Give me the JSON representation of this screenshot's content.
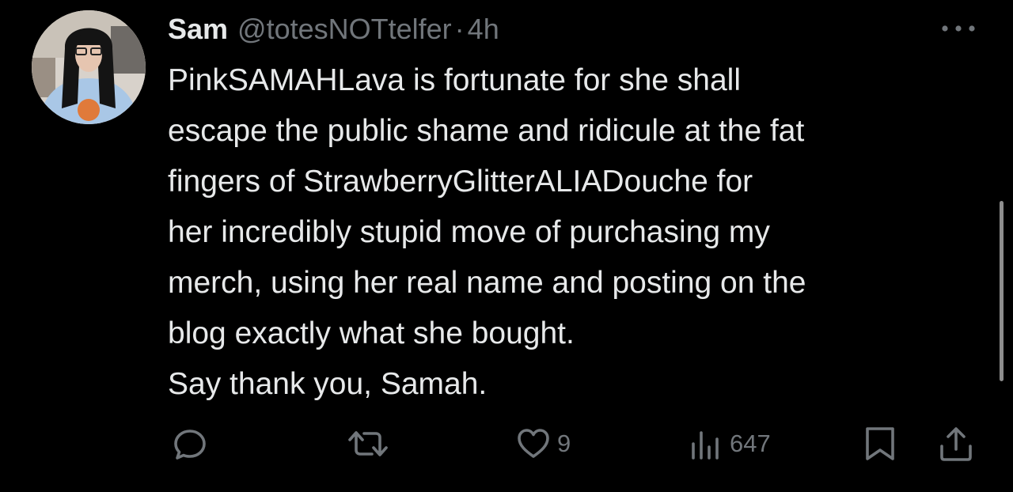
{
  "tweet": {
    "author": {
      "name": "Sam",
      "handle": "@totesNOTtelfer",
      "separator": "·",
      "time": "4h"
    },
    "text_lines": [
      "PinkSAMAHLava is fortunate for she shall",
      "escape the public shame and ridicule at the fat",
      "fingers of StrawberryGlitterALIADouche for",
      "her incredibly stupid move of purchasing my",
      "merch, using her real name and posting on the",
      "blog exactly what she bought.",
      "Say thank you, Samah."
    ],
    "actions": {
      "reply": {
        "icon": "reply-icon",
        "count": ""
      },
      "retweet": {
        "icon": "retweet-icon",
        "count": ""
      },
      "like": {
        "icon": "heart-icon",
        "count": "9"
      },
      "views": {
        "icon": "views-icon",
        "count": "647"
      },
      "bookmark": {
        "icon": "bookmark-icon"
      },
      "share": {
        "icon": "share-icon"
      }
    }
  },
  "colors": {
    "background": "#000000",
    "text_primary": "#e7e9ea",
    "text_secondary": "#71767b"
  }
}
